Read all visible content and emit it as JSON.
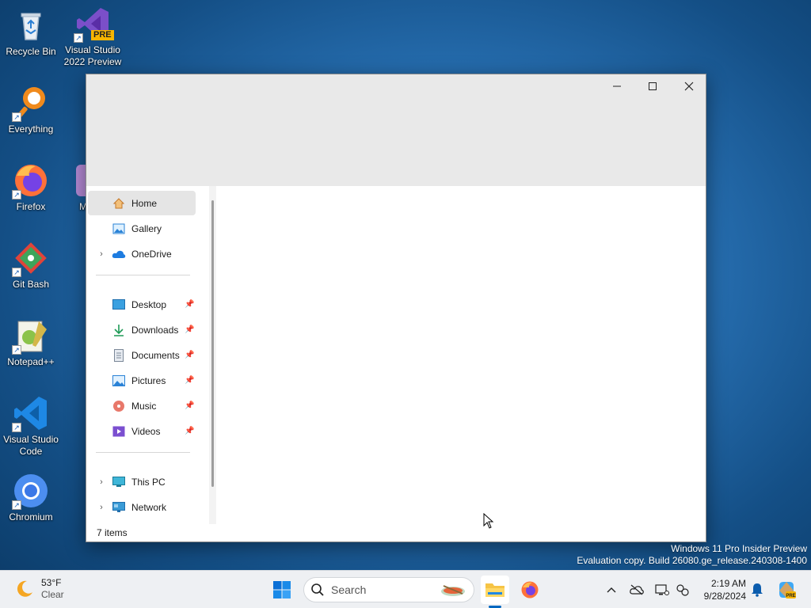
{
  "desktop": {
    "icons": [
      {
        "label": "Recycle Bin"
      },
      {
        "label": "Visual Studio 2022 Preview",
        "badge": "PRE"
      },
      {
        "label": "Everything"
      },
      {
        "label": "Firefox"
      },
      {
        "label": "Git Bash"
      },
      {
        "label": "Notepad++"
      },
      {
        "label": "Visual Studio Code"
      },
      {
        "label": "Chromium"
      }
    ],
    "partial_icon_label": "M"
  },
  "explorer": {
    "nav_items": [
      {
        "label": "Home",
        "icon": "home-icon",
        "selected": true
      },
      {
        "label": "Gallery",
        "icon": "gallery-icon"
      },
      {
        "label": "OneDrive",
        "icon": "onedrive-icon",
        "expandable": true
      },
      {
        "label": "Desktop",
        "icon": "desktop-folder-icon",
        "pinned": true
      },
      {
        "label": "Downloads",
        "icon": "downloads-icon",
        "pinned": true
      },
      {
        "label": "Documents",
        "icon": "documents-icon",
        "pinned": true
      },
      {
        "label": "Pictures",
        "icon": "pictures-icon",
        "pinned": true
      },
      {
        "label": "Music",
        "icon": "music-icon",
        "pinned": true
      },
      {
        "label": "Videos",
        "icon": "videos-icon",
        "pinned": true
      },
      {
        "label": "This PC",
        "icon": "this-pc-icon",
        "expandable": true
      },
      {
        "label": "Network",
        "icon": "network-icon",
        "expandable": true
      }
    ],
    "status": "7 items"
  },
  "watermark": {
    "line1": "Windows 11 Pro Insider Preview",
    "line2": "Evaluation copy. Build 26080.ge_release.240308-1400"
  },
  "taskbar": {
    "weather": {
      "temp": "53°F",
      "condition": "Clear"
    },
    "search_label": "Search",
    "clock": {
      "time": "2:19 AM",
      "date": "9/28/2024"
    }
  },
  "colors": {
    "accent": "#0067c0",
    "titlebar": "#e9e9e9"
  }
}
